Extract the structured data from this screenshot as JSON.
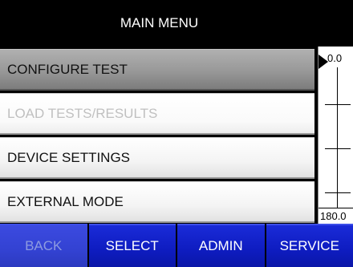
{
  "header": {
    "title": "MAIN MENU"
  },
  "menu": {
    "items": [
      {
        "label": "CONFIGURE TEST",
        "state": "selected"
      },
      {
        "label": "LOAD TESTS/RESULTS",
        "state": "disabled"
      },
      {
        "label": "DEVICE SETTINGS",
        "state": "normal"
      },
      {
        "label": "EXTERNAL MODE",
        "state": "normal"
      }
    ]
  },
  "scale": {
    "top_label": "0.0",
    "bottom_label": "180.0",
    "pointer_icon": "pointer-triangle-icon"
  },
  "buttons": {
    "back_label": "BACK",
    "select_label": "SELECT",
    "admin_label": "ADMIN",
    "service_label": "SERVICE"
  },
  "colors": {
    "button_blue": "#1224d0",
    "selected_item": "#989898",
    "disabled_text": "#c0c0c0"
  }
}
